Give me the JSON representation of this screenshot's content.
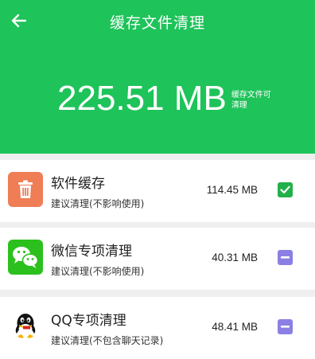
{
  "header": {
    "title": "缓存文件清理",
    "total_size": "225.51 MB",
    "caption": "缓存文件可清理"
  },
  "colors": {
    "brand_green": "#1ec35a",
    "checked": "#22b04a",
    "partial": "#8c7fe4",
    "trash_bg": "#ef7d55",
    "wechat_bg": "#2bc01d"
  },
  "items": [
    {
      "title": "软件缓存",
      "subtitle": "建议清理(不影响使用)",
      "size": "114.45 MB",
      "icon": "trash-icon",
      "state": "checked"
    },
    {
      "title": "微信专项清理",
      "subtitle": "建议清理(不影响使用)",
      "size": "40.31 MB",
      "icon": "wechat-icon",
      "state": "partial"
    },
    {
      "title": "QQ专项清理",
      "subtitle": "建议清理(不包含聊天记录)",
      "size": "48.41 MB",
      "icon": "qq-icon",
      "state": "partial"
    }
  ]
}
